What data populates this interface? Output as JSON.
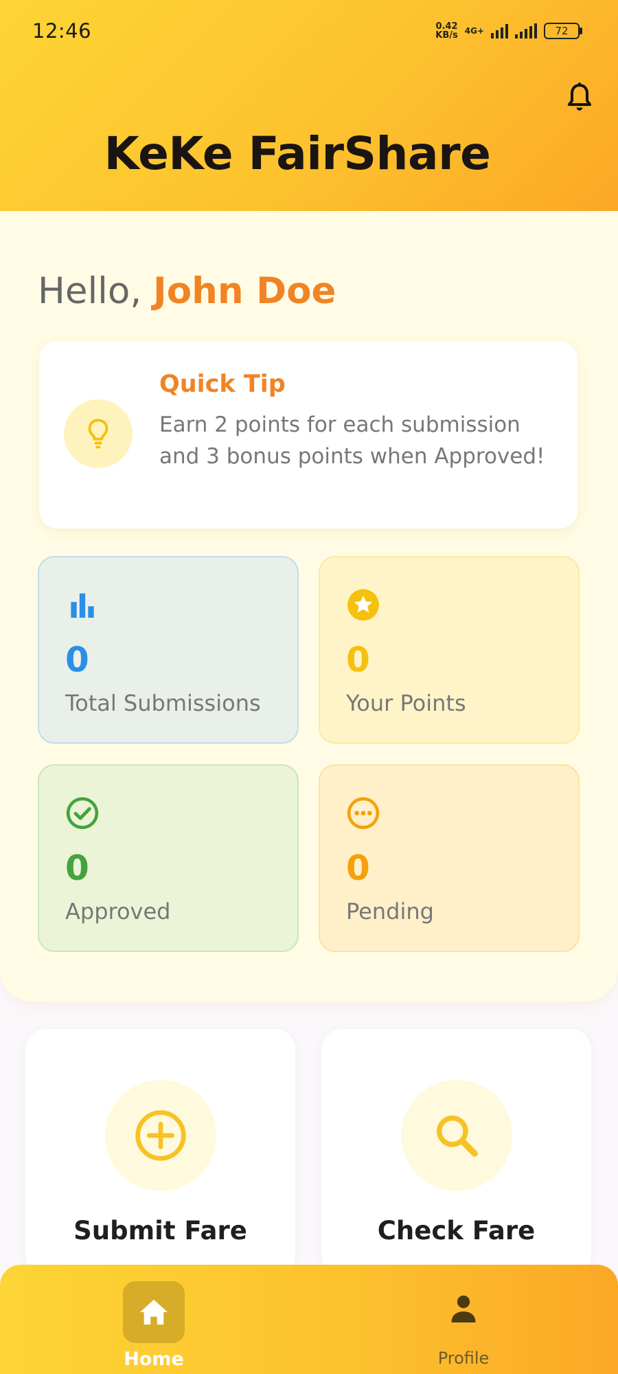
{
  "status_bar": {
    "time": "12:46",
    "net_speed_value": "0.42",
    "net_speed_unit": "KB/s",
    "net_type": "4G+",
    "battery": "72"
  },
  "header": {
    "title": "KeKe FairShare",
    "notification_icon": "bell-icon"
  },
  "greeting": {
    "prefix": "Hello,",
    "name": "John Doe"
  },
  "tip": {
    "title": "Quick Tip",
    "body": "Earn 2 points for each submission and 3 bonus points when Approved!",
    "icon": "lightbulb-icon"
  },
  "stats": {
    "total": {
      "value": "0",
      "label": "Total Submissions",
      "icon": "bar-chart-icon",
      "color": "#2a8fe6"
    },
    "points": {
      "value": "0",
      "label": "Your Points",
      "icon": "star-icon",
      "color": "#f5c10e"
    },
    "approved": {
      "value": "0",
      "label": "Approved",
      "icon": "check-circle-icon",
      "color": "#45a33c"
    },
    "pending": {
      "value": "0",
      "label": "Pending",
      "icon": "more-horizontal-icon",
      "color": "#f4a10e"
    }
  },
  "actions": {
    "submit": {
      "label": "Submit Fare",
      "icon": "plus-circle-icon"
    },
    "check": {
      "label": "Check Fare",
      "icon": "search-icon"
    }
  },
  "nav": {
    "home": {
      "label": "Home",
      "icon": "home-icon",
      "active": true
    },
    "profile": {
      "label": "Profile",
      "icon": "person-icon",
      "active": false
    }
  },
  "colors": {
    "brand_yellow": "#fdc22e",
    "accent_orange": "#f08424",
    "summary_bg": "#fffbe4"
  }
}
